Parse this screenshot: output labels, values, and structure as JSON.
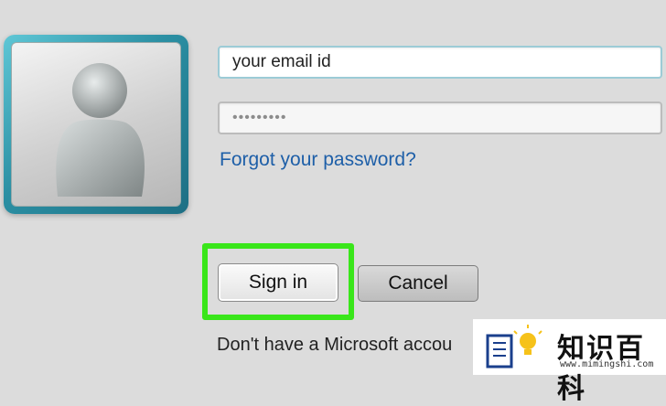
{
  "login": {
    "email_value": "your email id",
    "password_placeholder": "•••••••••",
    "forgot_link": "Forgot your password?",
    "signin_label": "Sign in",
    "cancel_label": "Cancel",
    "no_account_text": "Don't have a Microsoft accou"
  },
  "watermark": {
    "title": "知识百科",
    "url": "www.mimingshi.com"
  },
  "icons": {
    "avatar": "user-silhouette-icon",
    "watermark": "book-lightbulb-icon"
  },
  "colors": {
    "highlight": "#39e61a",
    "link": "#1e5fa8",
    "avatar_frame": "#2b8fa3"
  }
}
